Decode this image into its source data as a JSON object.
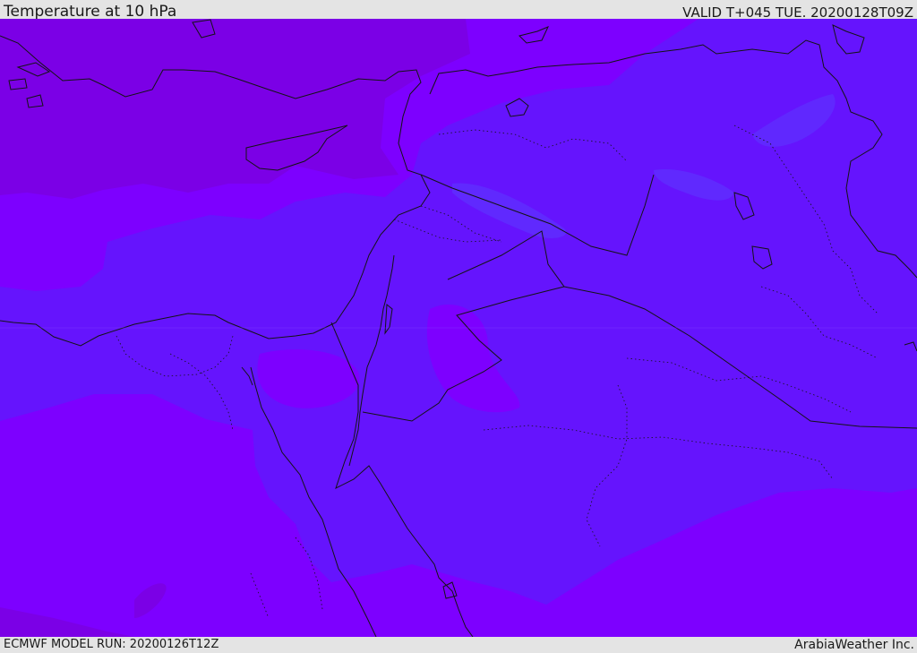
{
  "header": {
    "title": "Temperature at 10 hPa",
    "valid": "VALID T+045 TUE. 20200128T09Z"
  },
  "footer": {
    "model_run": "ECMWF MODEL RUN: 20200126T12Z",
    "credit": "ArabiaWeather Inc."
  },
  "colors": {
    "cold_band": "#6514fd",
    "mid_band": "#7d00ff",
    "warm_band": "#7b00e6",
    "lines": "#141414"
  }
}
